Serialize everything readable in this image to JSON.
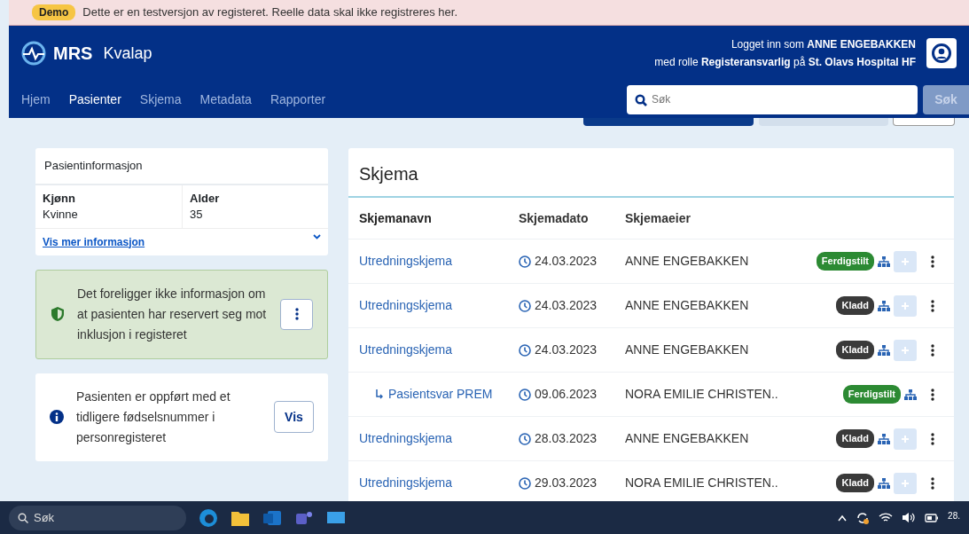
{
  "banner": {
    "badge": "Demo",
    "text": "Dette er en testversjon av registeret. Reelle data skal ikke registreres her."
  },
  "navbar": {
    "brand": "MRS",
    "app": "Kvalap",
    "nav": [
      {
        "label": "Hjem",
        "selected": false
      },
      {
        "label": "Pasienter",
        "selected": true
      },
      {
        "label": "Skjema",
        "selected": false
      },
      {
        "label": "Metadata",
        "selected": false
      },
      {
        "label": "Rapporter",
        "selected": false
      }
    ],
    "user_line_1": "Logget inn som **ANNE ENGEBAKKEN**",
    "user_line_2": "med rolle **Registeransvarlig** på **St. Olavs Hospital HF**",
    "search": {
      "placeholder": "Søk"
    },
    "search_button": {
      "label": "Søk",
      "disabled": true
    }
  },
  "patient_card": {
    "title": "Pasientinformasjon",
    "fields": [
      {
        "label": "Kjønn",
        "value": "Kvinne"
      },
      {
        "label": "Alder",
        "value": "35"
      }
    ],
    "more_link": "Vis mer informasjon"
  },
  "reservation_alert": {
    "text": "Det foreligger ikke informasjon om at pasienten har reservert seg mot inklusjon i registeret"
  },
  "info_alert": {
    "text": "Pasienten er oppført med et tidligere fødselsnummer i personregisteret",
    "button": "Vis"
  },
  "forms": {
    "title": "Skjema",
    "columns": [
      "Skjemanavn",
      "Skjemadato",
      "Skjemaeier"
    ],
    "rows": [
      {
        "name": "Utredningskjema",
        "date": "24.03.2023",
        "owner": "ANNE ENGEBAKKEN",
        "status": "Ferdigstilt",
        "color": "#2c8a33"
      },
      {
        "name": "Utredningskjema",
        "date": "24.03.2023",
        "owner": "ANNE ENGEBAKKEN",
        "status": "Kladd",
        "color": "#3a3a3a"
      },
      {
        "name": "Utredningskjema",
        "date": "24.03.2023",
        "owner": "ANNE ENGEBAKKEN",
        "status": "Kladd",
        "color": "#3a3a3a",
        "children": [
          {
            "name": "Pasientsvar PREM",
            "date": "09.06.2023",
            "owner": "NORA EMILIE CHRISTEN..",
            "status": "Ferdigstilt",
            "color": "#2c8a33"
          }
        ]
      },
      {
        "name": "Utredningskjema",
        "date": "28.03.2023",
        "owner": "ANNE ENGEBAKKEN",
        "status": "Kladd",
        "color": "#3a3a3a"
      },
      {
        "name": "Utredningskjema",
        "date": "29.03.2023",
        "owner": "NORA EMILIE CHRISTEN..",
        "status": "Kladd",
        "color": "#3a3a3a"
      }
    ]
  },
  "taskbar": {
    "search": "Søk",
    "clock": "28."
  }
}
